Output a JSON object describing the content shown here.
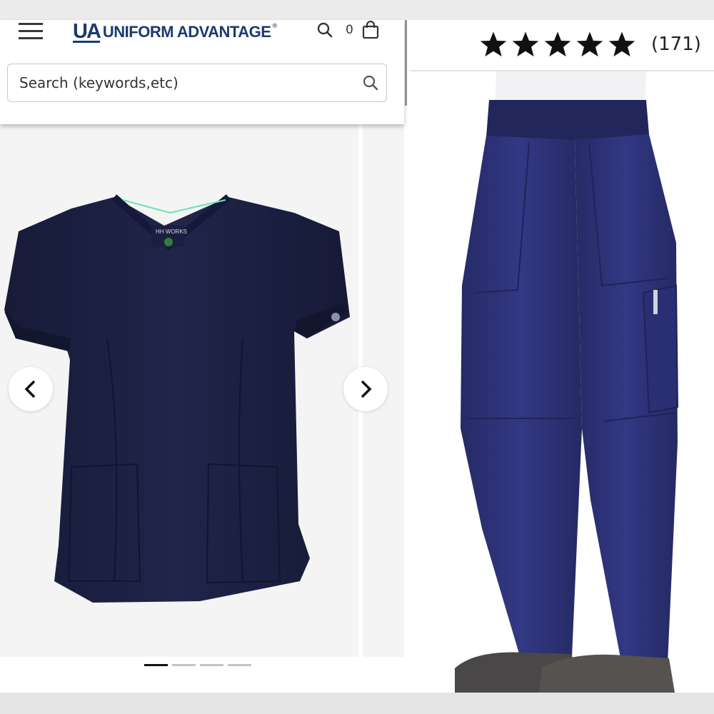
{
  "header": {
    "logo_mark": "UA",
    "logo_text": "UNIFORM ADVANTAGE",
    "logo_reg": "®",
    "cart_count": "0",
    "icons": [
      "hamburger-menu-icon",
      "search-icon",
      "shopping-bag-icon"
    ]
  },
  "search": {
    "placeholder": "Search (keywords,etc)"
  },
  "gallery": {
    "top_label": "HH WORKS",
    "prev_icon": "chevron-left-icon",
    "next_icon": "chevron-right-icon",
    "slide_count": 4,
    "active_slide": 1
  },
  "rating": {
    "stars": 5,
    "review_count": "(171)"
  },
  "colors": {
    "brand_navy": "#1d3a6e",
    "top_navy": "#1c2142",
    "pants_navy": "#2e3276",
    "dot_active": "#111111",
    "dot_inactive": "#c4c4c4"
  }
}
